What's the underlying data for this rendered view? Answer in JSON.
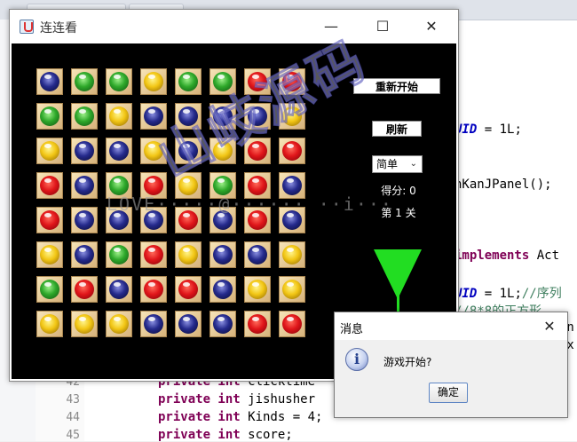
{
  "window": {
    "title": "连连看",
    "minimize_glyph": "—",
    "maximize_glyph": "☐",
    "close_glyph": "✕"
  },
  "game": {
    "board": [
      [
        "navy",
        "green",
        "green",
        "yellow",
        "green",
        "green",
        "red",
        "red"
      ],
      [
        "green",
        "green",
        "yellow",
        "navy",
        "navy",
        "navy",
        "navy",
        "yellow"
      ],
      [
        "yellow",
        "navy",
        "navy",
        "yellow",
        "navy",
        "yellow",
        "red",
        "red"
      ],
      [
        "red",
        "navy",
        "green",
        "red",
        "yellow",
        "green",
        "red",
        "navy"
      ],
      [
        "red",
        "navy",
        "navy",
        "navy",
        "red",
        "navy",
        "red",
        "navy"
      ],
      [
        "yellow",
        "navy",
        "green",
        "red",
        "yellow",
        "navy",
        "navy",
        "yellow"
      ],
      [
        "green",
        "red",
        "navy",
        "red",
        "red",
        "navy",
        "yellow",
        "yellow"
      ],
      [
        "yellow",
        "yellow",
        "yellow",
        "navy",
        "navy",
        "navy",
        "red",
        "red"
      ]
    ],
    "restart_label": "重新开始",
    "refresh_label": "刷新",
    "level_select_value": "简单",
    "score_text": "得分: 0",
    "stage_text": "第 1 关",
    "timer_color": "#22dd22"
  },
  "watermark": {
    "main_text": "山岐源码",
    "url_text": "LOVE·····@······ ··i···"
  },
  "dialog": {
    "title": "消息",
    "close_glyph": "✕",
    "message": "游戏开始?",
    "ok_label": "确定",
    "info_glyph": "i"
  },
  "ide": {
    "visible_fragments": [
      {
        "text": "UID",
        "suffix": " = 1L;"
      },
      {
        "text": "nKanJPanel();"
      },
      {
        "text": "implements",
        "suffix": " Act"
      },
      {
        "text": "UID",
        "suffix": " = 1L;",
        "comment": "//序列"
      },
      {
        "text": "",
        "comment": "//8*8的正方形"
      },
      {
        "text": "an"
      },
      {
        "text": "ex"
      }
    ],
    "lines": [
      {
        "num": "42",
        "kw": "private int",
        "rest": " clicktime"
      },
      {
        "num": "43",
        "kw": "private int",
        "rest": " jishusher"
      },
      {
        "num": "44",
        "kw": "private int",
        "rest": " Kinds = 4;"
      },
      {
        "num": "45",
        "kw": "private int",
        "rest": " score;"
      }
    ]
  }
}
